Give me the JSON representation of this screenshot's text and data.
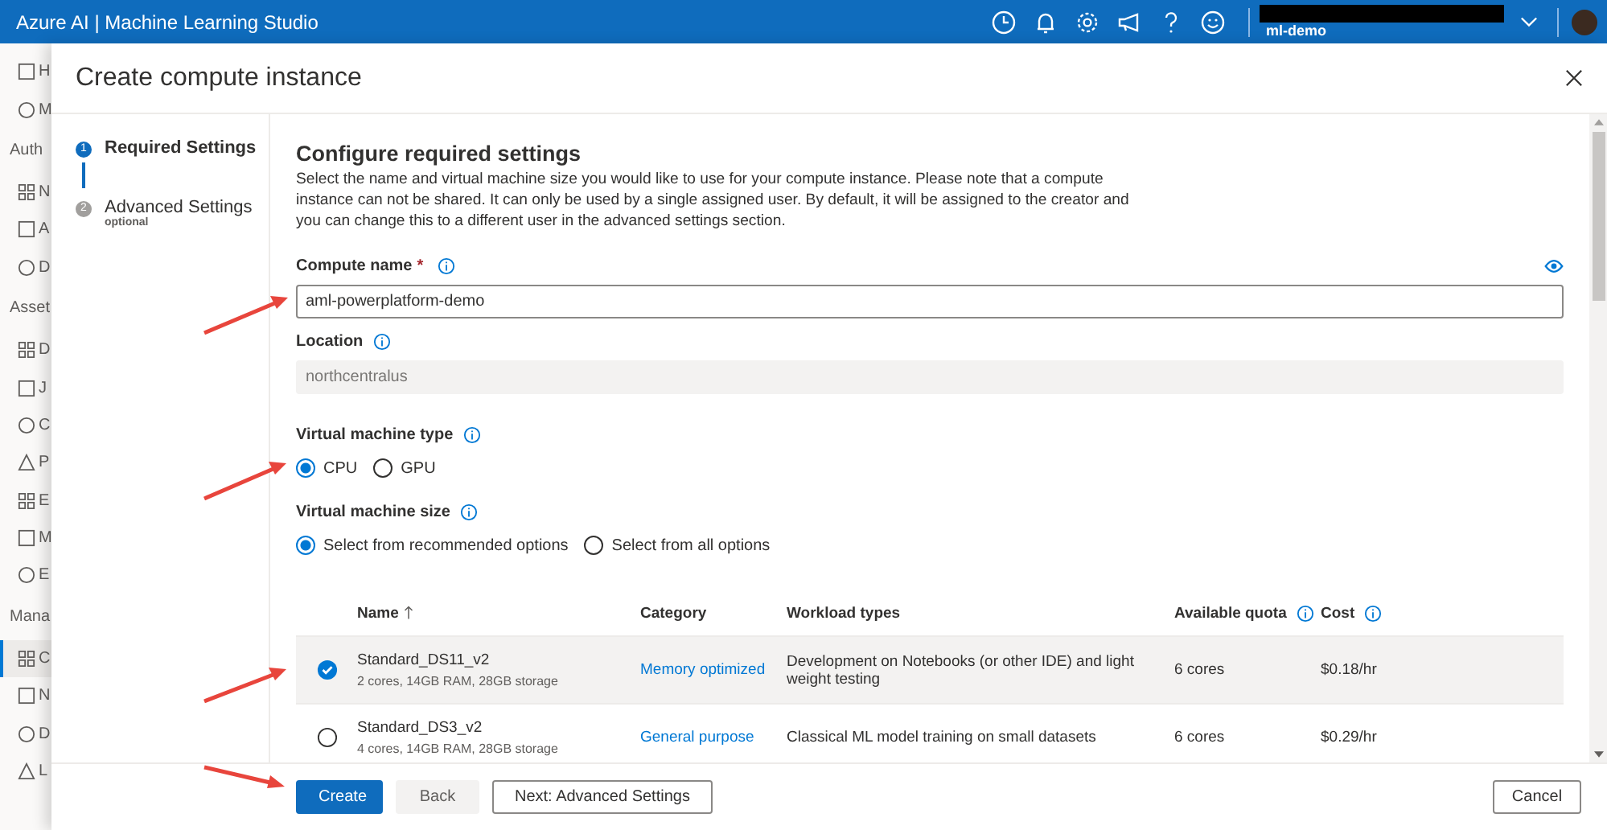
{
  "header": {
    "title": "Azure AI | Machine Learning Studio",
    "workspace": "ml-demo"
  },
  "sidebar": {
    "items": [
      {
        "kind": "link",
        "label": "H",
        "selected": false
      },
      {
        "kind": "link",
        "label": "M",
        "selected": false
      },
      {
        "kind": "section",
        "label": "Auth"
      },
      {
        "kind": "link",
        "label": "N",
        "selected": false
      },
      {
        "kind": "link",
        "label": "A",
        "selected": false
      },
      {
        "kind": "link",
        "label": "D",
        "selected": false
      },
      {
        "kind": "section",
        "label": "Asset"
      },
      {
        "kind": "link",
        "label": "D",
        "selected": false
      },
      {
        "kind": "link",
        "label": "J",
        "selected": false
      },
      {
        "kind": "link",
        "label": "C",
        "selected": false
      },
      {
        "kind": "link",
        "label": "P",
        "selected": false
      },
      {
        "kind": "link",
        "label": "E",
        "selected": false
      },
      {
        "kind": "link",
        "label": "M",
        "selected": false
      },
      {
        "kind": "link",
        "label": "E",
        "selected": false
      },
      {
        "kind": "section",
        "label": "Mana"
      },
      {
        "kind": "link",
        "label": "C",
        "selected": true
      },
      {
        "kind": "link",
        "label": "N",
        "selected": false
      },
      {
        "kind": "link",
        "label": "D",
        "selected": false
      },
      {
        "kind": "link",
        "label": "L",
        "selected": false
      }
    ]
  },
  "dialog": {
    "title": "Create compute instance",
    "steps": [
      {
        "number": "1",
        "label": "Required Settings",
        "selected": true
      },
      {
        "number": "2",
        "label": "Advanced Settings",
        "sublabel": "optional",
        "selected": false
      }
    ],
    "heading": "Configure required settings",
    "description": "Select the name and virtual machine size you would like to use for your compute instance. Please note that a compute instance can not be shared. It can only be used by a single assigned user. By default, it will be assigned to the creator and you can change this to a different user in the advanced settings section.",
    "compute_name": {
      "label": "Compute name",
      "required_mark": "*",
      "value": "aml-powerplatform-demo"
    },
    "location": {
      "label": "Location",
      "value": "northcentralus",
      "disabled": true
    },
    "vm_type": {
      "label": "Virtual machine type",
      "options": [
        {
          "label": "CPU",
          "selected": true
        },
        {
          "label": "GPU",
          "selected": false
        }
      ]
    },
    "vm_size": {
      "label": "Virtual machine size",
      "options": [
        {
          "label": "Select from recommended options",
          "selected": true
        },
        {
          "label": "Select from all options",
          "selected": false
        }
      ]
    },
    "table": {
      "columns": [
        {
          "label": "Name",
          "sorted": true,
          "info": false
        },
        {
          "label": "Category",
          "sorted": false,
          "info": false
        },
        {
          "label": "Workload types",
          "sorted": false,
          "info": false
        },
        {
          "label": "Available quota",
          "sorted": false,
          "info": true
        },
        {
          "label": "Cost",
          "sorted": false,
          "info": true
        }
      ],
      "rows": [
        {
          "selected": true,
          "name": "Standard_DS11_v2",
          "specs": "2 cores, 14GB RAM, 28GB storage",
          "category": "Memory optimized",
          "workload": "Development on Notebooks (or other IDE) and light weight testing",
          "quota": "6 cores",
          "cost": "$0.18/hr"
        },
        {
          "selected": false,
          "name": "Standard_DS3_v2",
          "specs": "4 cores, 14GB RAM, 28GB storage",
          "category": "General purpose",
          "workload": "Classical ML model training on small datasets",
          "quota": "6 cores",
          "cost": "$0.29/hr"
        }
      ]
    },
    "footer": {
      "buttons": [
        {
          "kind": "primary",
          "label": "Create"
        },
        {
          "kind": "disabled",
          "label": "Back"
        },
        {
          "kind": "default",
          "label": "Next: Advanced Settings"
        }
      ],
      "cancel": "Cancel"
    }
  }
}
